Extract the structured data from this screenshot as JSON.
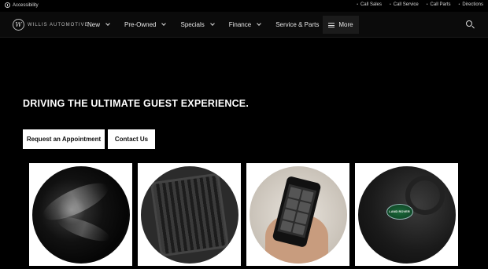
{
  "topbar": {
    "accessibility_label": "Accessibility",
    "utility_links": [
      {
        "label": "Call Sales"
      },
      {
        "label": "Call Service"
      },
      {
        "label": "Call Parts"
      },
      {
        "label": "Directions"
      }
    ]
  },
  "nav": {
    "logo_text": "WILLIS AUTOMOTIVE",
    "logo_mark": "W",
    "items": [
      {
        "label": "New"
      },
      {
        "label": "Pre-Owned"
      },
      {
        "label": "Specials"
      },
      {
        "label": "Finance"
      },
      {
        "label": "Service & Parts"
      }
    ],
    "more_label": "More"
  },
  "hero": {
    "headline": "DRIVING THE ULTIMATE GUEST EXPERIENCE.",
    "primary_button": "Request an Appointment",
    "secondary_button": "Contact Us"
  },
  "cards": [
    {
      "icon": "paint-protection-image"
    },
    {
      "icon": "floor-mat-image"
    },
    {
      "icon": "smartphone-app-image"
    },
    {
      "icon": "land-rover-badge-image",
      "badge_text": "LAND ROVER"
    }
  ],
  "colors": {
    "background": "#000000",
    "nav_background": "#0b0b0b",
    "button_background": "#ffffff",
    "button_text": "#111111"
  }
}
